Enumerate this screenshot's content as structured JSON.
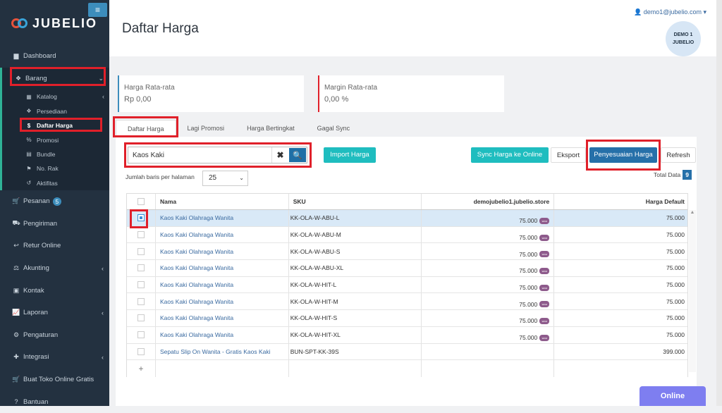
{
  "brand": {
    "name": "JUBELIO"
  },
  "header": {
    "title": "Daftar Harga",
    "user_email": "demo1@jubelio.com",
    "avatar_text": "DEMO 1 JUBELIO"
  },
  "sidebar": {
    "items": [
      {
        "label": "Dashboard",
        "icon": "chart-icon"
      },
      {
        "label": "Barang",
        "icon": "cubes-icon"
      },
      {
        "label": "Pesanan",
        "icon": "cart-icon",
        "badge": "5"
      },
      {
        "label": "Pengiriman",
        "icon": "truck-icon"
      },
      {
        "label": "Retur Online",
        "icon": "reply-icon"
      },
      {
        "label": "Akunting",
        "icon": "scale-icon"
      },
      {
        "label": "Kontak",
        "icon": "contact-icon"
      },
      {
        "label": "Laporan",
        "icon": "line-chart-icon"
      },
      {
        "label": "Pengaturan",
        "icon": "gears-icon"
      },
      {
        "label": "Integrasi",
        "icon": "puzzle-icon"
      },
      {
        "label": "Buat Toko Online Gratis",
        "icon": "cart-icon"
      },
      {
        "label": "Bantuan",
        "icon": "help-icon"
      }
    ],
    "barang_sub": [
      {
        "label": "Katalog",
        "icon": "grid-icon"
      },
      {
        "label": "Persediaan",
        "icon": "cubes-icon"
      },
      {
        "label": "Daftar Harga",
        "icon": "dollar-icon"
      },
      {
        "label": "Promosi",
        "icon": "percent-icon"
      },
      {
        "label": "Bundle",
        "icon": "bundle-icon"
      },
      {
        "label": "No. Rak",
        "icon": "bookmark-icon"
      },
      {
        "label": "Aktifitas",
        "icon": "history-icon"
      }
    ]
  },
  "cards": [
    {
      "label": "Harga Rata-rata",
      "value": "Rp 0,00",
      "color": "#3c8dbc"
    },
    {
      "label": "Margin Rata-rata",
      "value": "0,00 %",
      "color": "#e0202a"
    }
  ],
  "tabs": [
    "Daftar Harga",
    "Lagi Promosi",
    "Harga Bertingkat",
    "Gagal Sync"
  ],
  "toolbar": {
    "search_value": "Kaos Kaki",
    "import": "Import Harga",
    "sync": "Sync Harga ke Online",
    "eksport": "Eksport",
    "penyesuaian": "Penyesuaian Harga",
    "refresh": "Refresh"
  },
  "pagination": {
    "label": "Jumlah baris per halaman",
    "value": "25",
    "total_label": "Total Data",
    "total": "9"
  },
  "table": {
    "columns": [
      "Nama",
      "SKU",
      "demojubelio1.jubelio.store",
      "Harga Default"
    ],
    "rows": [
      {
        "name": "Kaos Kaki Olahraga Wanita",
        "sku": "KK-OLA-W-ABU-L",
        "store": "75.000",
        "price": "75.000"
      },
      {
        "name": "Kaos Kaki Olahraga Wanita",
        "sku": "KK-OLA-W-ABU-M",
        "store": "75.000",
        "price": "75.000"
      },
      {
        "name": "Kaos Kaki Olahraga Wanita",
        "sku": "KK-OLA-W-ABU-S",
        "store": "75.000",
        "price": "75.000"
      },
      {
        "name": "Kaos Kaki Olahraga Wanita",
        "sku": "KK-OLA-W-ABU-XL",
        "store": "75.000",
        "price": "75.000"
      },
      {
        "name": "Kaos Kaki Olahraga Wanita",
        "sku": "KK-OLA-W-HIT-L",
        "store": "75.000",
        "price": "75.000"
      },
      {
        "name": "Kaos Kaki Olahraga Wanita",
        "sku": "KK-OLA-W-HIT-M",
        "store": "75.000",
        "price": "75.000"
      },
      {
        "name": "Kaos Kaki Olahraga Wanita",
        "sku": "KK-OLA-W-HIT-S",
        "store": "75.000",
        "price": "75.000"
      },
      {
        "name": "Kaos Kaki Olahraga Wanita",
        "sku": "KK-OLA-W-HIT-XL",
        "store": "75.000",
        "price": "75.000"
      },
      {
        "name": "Sepatu Slip On Wanita - Gratis Kaos Kaki",
        "sku": "BUN-SPT-KK-39S",
        "store": "",
        "price": "399.000"
      }
    ]
  },
  "online_label": "Online"
}
